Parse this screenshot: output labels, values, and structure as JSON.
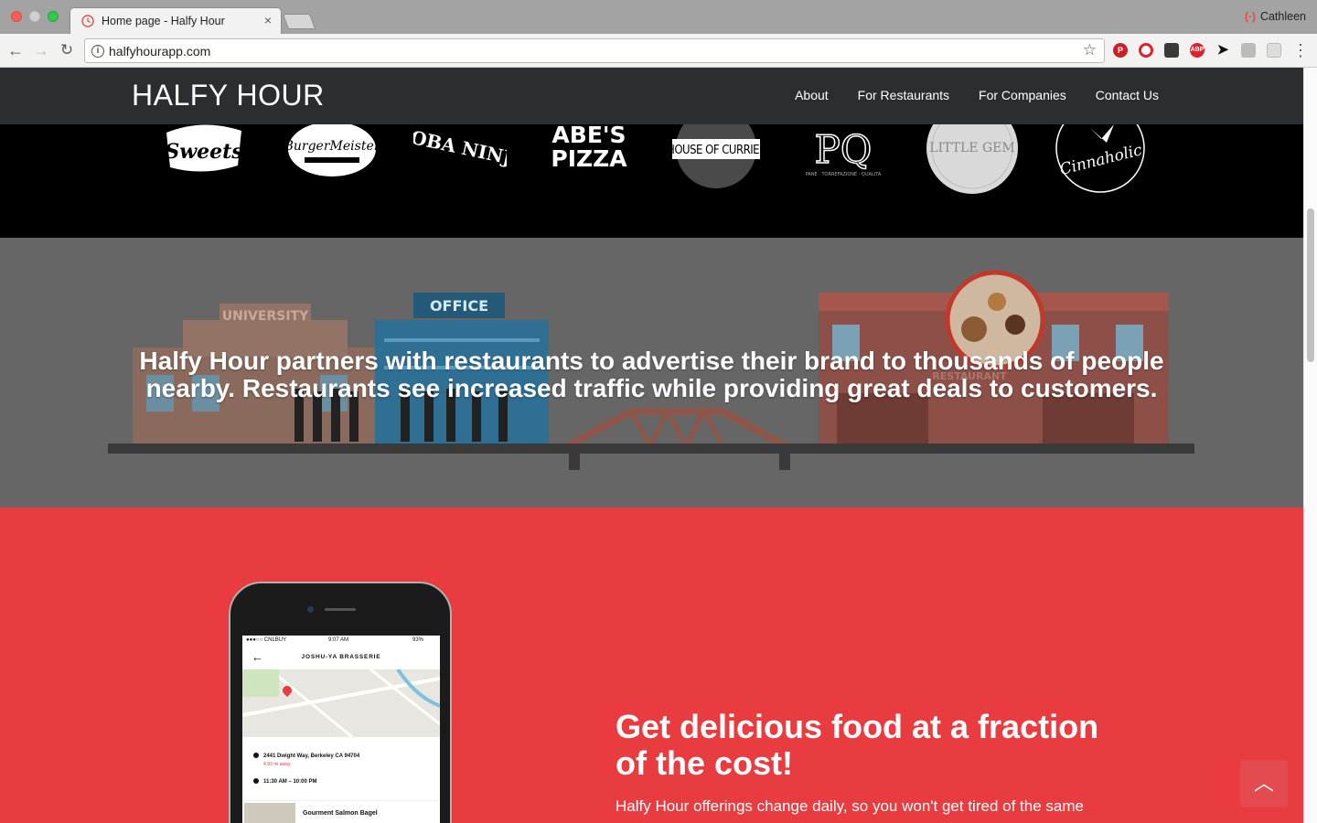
{
  "browser": {
    "tab_title": "Home page - Halfy Hour",
    "tab_close": "×",
    "profile_name": "Cathleen",
    "url": "halfyhourapp.com",
    "back_glyph": "←",
    "forward_glyph": "→",
    "reload_glyph": "↻",
    "star_glyph": "☆",
    "menu_glyph": "⋮",
    "extensions": [
      "pinterest-icon",
      "opera-icon",
      "evernote-icon",
      "adblock-icon",
      "cursor-icon",
      "extension-icon",
      "extension-icon"
    ]
  },
  "site": {
    "brand": "HALFY HOUR",
    "nav": [
      "About",
      "For Restaurants",
      "For Companies",
      "Contact Us"
    ],
    "restaurant_logos": [
      {
        "name": "Indian Summer Sweets",
        "text": "Sweets"
      },
      {
        "name": "BurgerMeister",
        "text": "BurgerMeister"
      },
      {
        "name": "Boba Ninja",
        "text": "BOBA NINJA"
      },
      {
        "name": "Abe's Pizza",
        "text": "ABE'S PIZZA"
      },
      {
        "name": "House of Curries",
        "text": "HOUSE OF CURRIES"
      },
      {
        "name": "Pane",
        "text": "PQ"
      },
      {
        "name": "Little Gem",
        "text": "LITTLE GEM"
      },
      {
        "name": "Cinnaholic",
        "text": "Cinnaholic"
      }
    ],
    "hero": {
      "text": "Halfy Hour partners with restaurants to advertise their brand to thousands of people nearby.  Restaurants see increased traffic while providing great deals to customers.",
      "sign_university": "UNIVERSITY",
      "sign_office": "OFFICE",
      "sign_restaurant": "RESTAURANT"
    },
    "feature": {
      "headline": "Get delicious food at a fraction of the cost!",
      "body": "Halfy Hour offerings change daily, so you won't get tired of the same"
    },
    "phone": {
      "carrier": "●●●○○ CNLBUY",
      "time": "9:07 AM",
      "battery": "93%",
      "title": "JOSHU-YA BRASSERIE",
      "address": "2441 Dwight Way, Berkeley CA 94704",
      "distance": "4.93 mi away",
      "hours": "11:30 AM – 10:00 PM",
      "item": "Gourment Salmon Bagel"
    },
    "scroll_top_glyph": "︿"
  },
  "colors": {
    "nav_bg": "#2b2e30",
    "red": "#e83c40",
    "hero_bg": "#666666"
  }
}
